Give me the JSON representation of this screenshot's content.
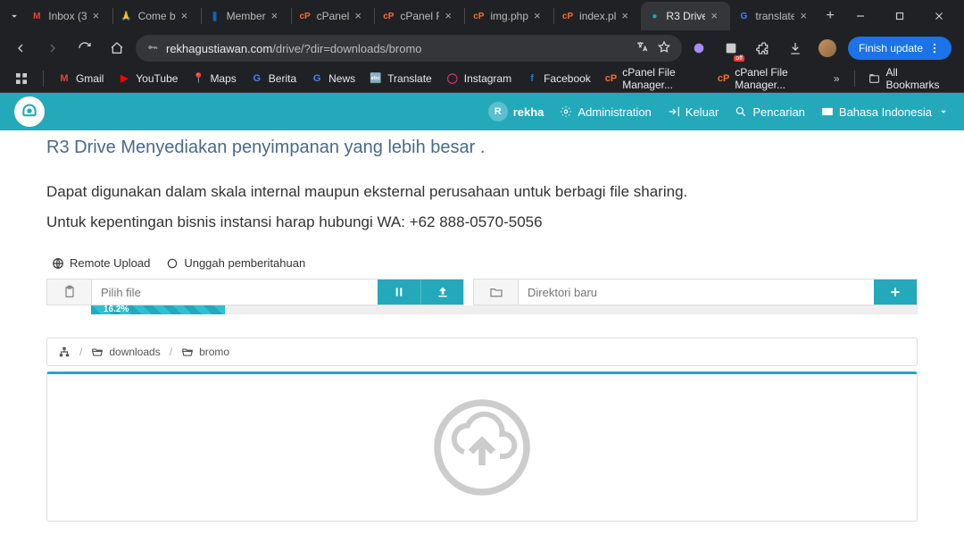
{
  "browser": {
    "tabs": [
      {
        "title": "Inbox (3",
        "faviconColor": "#ea4335",
        "faviconLetter": "M"
      },
      {
        "title": "Come b",
        "faviconColor": "#f0a020",
        "faviconLetter": "🙏"
      },
      {
        "title": "Member",
        "faviconColor": "#0a66c2",
        "faviconLetter": "❚"
      },
      {
        "title": "cPanel",
        "faviconColor": "#ff6c2c",
        "faviconLetter": "cP"
      },
      {
        "title": "cPanel F",
        "faviconColor": "#ff6c2c",
        "faviconLetter": "cP"
      },
      {
        "title": "img.php",
        "faviconColor": "#ff6c2c",
        "faviconLetter": "cP"
      },
      {
        "title": "index.pl",
        "faviconColor": "#ff6c2c",
        "faviconLetter": "cP"
      },
      {
        "title": "R3 Drive",
        "faviconColor": "#23a9ba",
        "faviconLetter": "●",
        "active": true
      },
      {
        "title": "translate",
        "faviconColor": "#4285f4",
        "faviconLetter": "G"
      }
    ],
    "url_host": "rekhagustiawan.com",
    "url_path": "/drive/?dir=downloads/bromo",
    "finish_update": "Finish update",
    "bookmarks": [
      {
        "label": "Gmail",
        "color": "#ea4335",
        "letter": "M"
      },
      {
        "label": "YouTube",
        "color": "#ff0000",
        "letter": "▶"
      },
      {
        "label": "Maps",
        "color": "#34a853",
        "letter": "📍"
      },
      {
        "label": "Berita",
        "color": "#4285f4",
        "letter": "G"
      },
      {
        "label": "News",
        "color": "#4285f4",
        "letter": "G"
      },
      {
        "label": "Translate",
        "color": "#4285f4",
        "letter": "🔤"
      },
      {
        "label": "Instagram",
        "color": "#e1306c",
        "letter": "◯"
      },
      {
        "label": "Facebook",
        "color": "#1877f2",
        "letter": "f"
      },
      {
        "label": "cPanel File Manager...",
        "color": "#ff6c2c",
        "letter": "cP"
      },
      {
        "label": "cPanel File Manager...",
        "color": "#ff6c2c",
        "letter": "cP"
      }
    ],
    "all_bookmarks": "All Bookmarks"
  },
  "header": {
    "user_initial": "R",
    "user_name": "rekha",
    "admin": "Administration",
    "logout": "Keluar",
    "search": "Pencarian",
    "language": "Bahasa Indonesia"
  },
  "content": {
    "headline": "R3 Drive Menyediakan penyimpanan yang lebih besar .",
    "line1": "Dapat digunakan dalam skala internal maupun eksternal perusahaan untuk berbagi file sharing.",
    "line2": "Untuk kepentingan bisnis instansi harap hubungi WA: +62 888-0570-5056"
  },
  "toolbar": {
    "remote_upload": "Remote Upload",
    "upload_notify": "Unggah pemberitahuan"
  },
  "inputs": {
    "file_placeholder": "Pilih file",
    "dir_placeholder": "Direktori baru"
  },
  "progress": {
    "percent": 16.2,
    "label": "16.2%"
  },
  "breadcrumb": {
    "seg1": "downloads",
    "seg2": "bromo"
  }
}
